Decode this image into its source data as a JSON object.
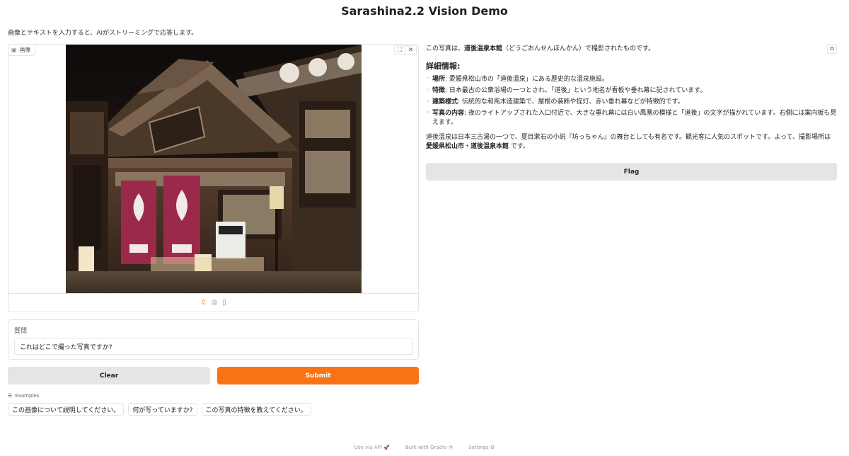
{
  "header": {
    "title": "Sarashina2.2 Vision Demo",
    "subtitle": "画像とテキストを入力すると、AIがストリーミングで応答します。"
  },
  "image_panel": {
    "label": "画像",
    "label_icon": "image-icon",
    "fullscreen_icon": "fullscreen-icon",
    "close_icon": "close-icon",
    "footer_icons": [
      "upload-icon",
      "webcam-icon",
      "clipboard-icon"
    ]
  },
  "question": {
    "label": "質問",
    "value": "これはどこで撮った写真ですか?"
  },
  "buttons": {
    "clear": "Clear",
    "submit": "Submit",
    "flag": "Flag"
  },
  "examples": {
    "label": "Examples",
    "items": [
      "この画像について説明してください。",
      "何が写っていますか?",
      "この写真の特徴を教えてください。"
    ]
  },
  "output": {
    "intro_prefix": "この写真は、",
    "intro_bold": "道後温泉本館",
    "intro_suffix": "（どうごおんせんほんかん）で撮影されたものです。",
    "details_heading": "詳細情報:",
    "details": [
      {
        "key": "場所",
        "text": ": 愛媛県松山市の「道後温泉」にある歴史的な温泉施設。"
      },
      {
        "key": "特徴",
        "text": ": 日本最古の公衆浴場の一つとされ、「道後」という地名が看板や垂れ幕に記されています。"
      },
      {
        "key": "建築様式",
        "text": ": 伝統的な和風木造建築で、屋根の装飾や提灯、赤い垂れ幕などが特徴的です。"
      },
      {
        "key": "写真の内容",
        "text": ": 夜のライトアップされた入口付近で、大きな垂れ幕には白い鳳凰の模様と「道後」の文字が描かれています。右側には案内板も見えます。"
      }
    ],
    "closing_prefix": "道後温泉は日本三古湯の一つで、夏目漱石の小説『坊っちゃん』の舞台としても有名です。観光客に人気のスポットです。よって、撮影場所は ",
    "closing_bold": "愛媛県松山市・道後温泉本館",
    "closing_suffix": " です。"
  },
  "footer": {
    "api": "Use via API",
    "built": "Built with Gradio",
    "settings": "Settings"
  }
}
